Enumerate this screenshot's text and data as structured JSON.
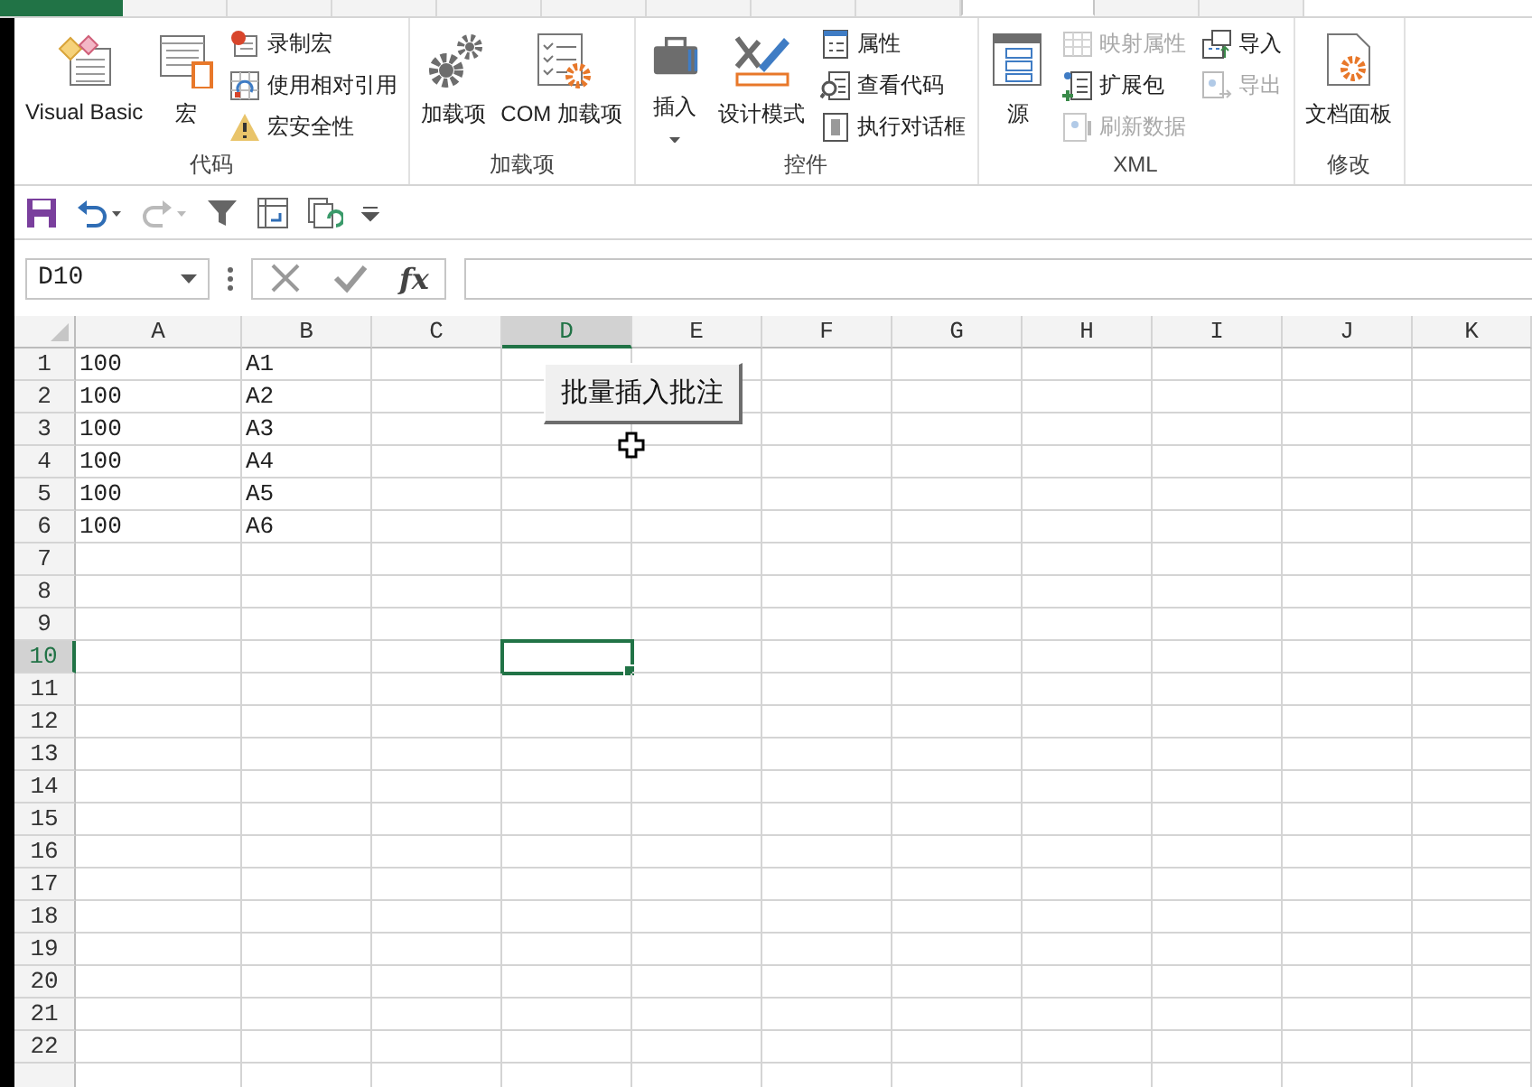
{
  "ribbon_tabs": [
    {
      "kind": "file",
      "selected": false
    },
    {
      "kind": "tab",
      "selected": false
    },
    {
      "kind": "tab",
      "selected": false
    },
    {
      "kind": "tab",
      "selected": false
    },
    {
      "kind": "tab",
      "selected": false
    },
    {
      "kind": "tab",
      "selected": false
    },
    {
      "kind": "tab",
      "selected": false
    },
    {
      "kind": "tab",
      "selected": false
    },
    {
      "kind": "tab",
      "selected": false
    },
    {
      "kind": "tab",
      "selected": true
    },
    {
      "kind": "tab",
      "selected": false
    },
    {
      "kind": "tab",
      "selected": false
    }
  ],
  "ribbon": {
    "groups": [
      {
        "label": "代码",
        "columns": [
          [
            {
              "kind": "large",
              "label": "Visual Basic",
              "disabled": false
            }
          ],
          [
            {
              "kind": "large",
              "label": "宏",
              "disabled": false
            }
          ],
          [
            {
              "kind": "small",
              "label": "录制宏",
              "disabled": false
            },
            {
              "kind": "small",
              "label": "使用相对引用",
              "disabled": false
            },
            {
              "kind": "small",
              "label": "宏安全性",
              "disabled": false
            }
          ]
        ]
      },
      {
        "label": "加载项",
        "columns": [
          [
            {
              "kind": "large",
              "label": "加载项",
              "disabled": false
            }
          ],
          [
            {
              "kind": "large",
              "label": "COM 加载项",
              "disabled": false
            }
          ]
        ]
      },
      {
        "label": "控件",
        "columns": [
          [
            {
              "kind": "large",
              "label": "插入",
              "disabled": false,
              "dropdown": true
            }
          ],
          [
            {
              "kind": "large",
              "label": "设计模式",
              "disabled": false
            }
          ],
          [
            {
              "kind": "small",
              "label": "属性",
              "disabled": false
            },
            {
              "kind": "small",
              "label": "查看代码",
              "disabled": false
            },
            {
              "kind": "small",
              "label": "执行对话框",
              "disabled": false
            }
          ]
        ]
      },
      {
        "label": "XML",
        "columns": [
          [
            {
              "kind": "large",
              "label": "源",
              "disabled": false
            }
          ],
          [
            {
              "kind": "small",
              "label": "映射属性",
              "disabled": true
            },
            {
              "kind": "small",
              "label": "扩展包",
              "disabled": false
            },
            {
              "kind": "small",
              "label": "刷新数据",
              "disabled": true
            }
          ],
          [
            {
              "kind": "small",
              "label": "导入",
              "disabled": false
            },
            {
              "kind": "small",
              "label": "导出",
              "disabled": true
            }
          ]
        ]
      },
      {
        "label": "修改",
        "columns": [
          [
            {
              "kind": "large",
              "label": "文档面板",
              "disabled": false
            }
          ]
        ]
      }
    ]
  },
  "quick_access": [
    {
      "disabled": false
    },
    {
      "disabled": false
    },
    {
      "disabled": true
    },
    {
      "disabled": false
    },
    {
      "disabled": false
    },
    {
      "disabled": false
    },
    {
      "disabled": false
    }
  ],
  "formula_bar": {
    "name_box": "D10",
    "fx": "fx"
  },
  "grid": {
    "columns": [
      {
        "label": "A",
        "selected": false
      },
      {
        "label": "B",
        "selected": false
      },
      {
        "label": "C",
        "selected": false
      },
      {
        "label": "D",
        "selected": true
      },
      {
        "label": "E",
        "selected": false
      },
      {
        "label": "F",
        "selected": false
      },
      {
        "label": "G",
        "selected": false
      },
      {
        "label": "H",
        "selected": false
      },
      {
        "label": "I",
        "selected": false
      },
      {
        "label": "J",
        "selected": false
      },
      {
        "label": "K",
        "selected": false
      }
    ],
    "rows": [
      {
        "label": "1",
        "selected": false,
        "cells": [
          "100",
          "A1"
        ]
      },
      {
        "label": "2",
        "selected": false,
        "cells": [
          "100",
          "A2"
        ]
      },
      {
        "label": "3",
        "selected": false,
        "cells": [
          "100",
          "A3"
        ]
      },
      {
        "label": "4",
        "selected": false,
        "cells": [
          "100",
          "A4"
        ]
      },
      {
        "label": "5",
        "selected": false,
        "cells": [
          "100",
          "A5"
        ]
      },
      {
        "label": "6",
        "selected": false,
        "cells": [
          "100",
          "A6"
        ]
      },
      {
        "label": "7",
        "selected": false
      },
      {
        "label": "8",
        "selected": false
      },
      {
        "label": "9",
        "selected": false
      },
      {
        "label": "10",
        "selected": true
      },
      {
        "label": "11",
        "selected": false
      },
      {
        "label": "12",
        "selected": false
      },
      {
        "label": "13",
        "selected": false
      },
      {
        "label": "14",
        "selected": false
      },
      {
        "label": "15",
        "selected": false
      },
      {
        "label": "16",
        "selected": false
      },
      {
        "label": "17",
        "selected": false
      },
      {
        "label": "18",
        "selected": false
      },
      {
        "label": "19",
        "selected": false
      },
      {
        "label": "20",
        "selected": false
      },
      {
        "label": "21",
        "selected": false
      },
      {
        "label": "22",
        "selected": false
      }
    ],
    "form_button": {
      "label": "批量插入批注"
    }
  }
}
